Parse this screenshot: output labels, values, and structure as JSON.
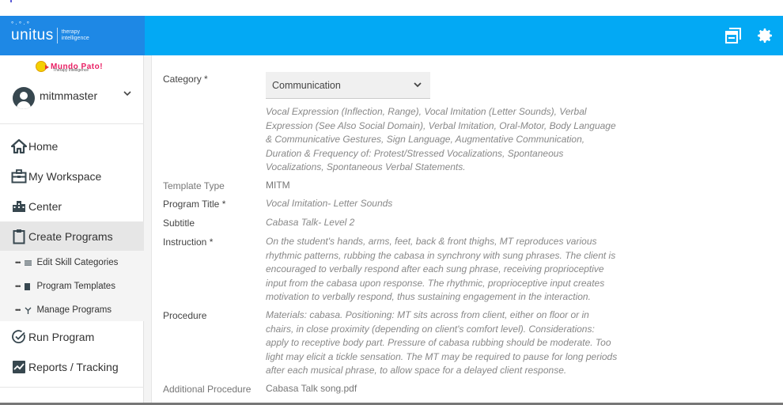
{
  "header": {
    "brand_name": "unitus",
    "brand_tagline_1": "therapy",
    "brand_tagline_2": "intelligence",
    "icons": [
      "windows-icon",
      "gear-icon"
    ]
  },
  "sidebar": {
    "partner_logo_title": "Mundo Pato!",
    "partner_logo_subtitle": "Therapy Intelligence",
    "username": "mitmmaster",
    "nav": [
      {
        "label": "Home",
        "icon": "home-icon"
      },
      {
        "label": "My Workspace",
        "icon": "briefcase-icon"
      },
      {
        "label": "Center",
        "icon": "building-icon"
      },
      {
        "label": "Create Programs",
        "icon": "clipboard-icon",
        "active": true
      },
      {
        "label": "Run Program",
        "icon": "check-circle-icon"
      },
      {
        "label": "Reports / Tracking",
        "icon": "chart-icon"
      }
    ],
    "sub_nav": [
      {
        "label": "Edit Skill Categories",
        "icon": "list-icon"
      },
      {
        "label": "Program Templates",
        "icon": "bookmark-icon"
      },
      {
        "label": "Manage Programs",
        "icon": "branch-icon"
      }
    ]
  },
  "form": {
    "category": {
      "label": "Category *",
      "value": "Communication",
      "description": "Vocal Expression (Inflection, Range), Vocal Imitation (Letter Sounds), Verbal Expression (See Also Social Domain), Verbal Imitation, Oral-Motor, Body Language & Communicative Gestures, Sign Language, Augmentative Communication, Duration & Frequency of: Protest/Stressed Vocalizations, Spontaneous Vocalizations, Spontaneous Verbal Statements."
    },
    "template_type": {
      "label": "Template Type",
      "value": "MITM"
    },
    "program_title": {
      "label": "Program Title *",
      "value": "Vocal Imitation- Letter Sounds"
    },
    "subtitle": {
      "label": "Subtitle",
      "value": "Cabasa Talk- Level 2"
    },
    "instruction": {
      "label": "Instruction *",
      "value": "On the student's hands, arms, feet, back & front thighs, MT reproduces various rhythmic patterns, rubbing the cabasa in synchrony with sung phrases. The client is encouraged to verbally respond after each sung phrase, receiving proprioceptive input from the cabasa upon response. The rhythmic, proprioceptive input creates motivation to verbally respond, thus sustaining engagement in the interaction."
    },
    "procedure": {
      "label": "Procedure",
      "value": "Materials: cabasa. Positioning: MT sits across from client, either on floor or in chairs, in close proximity (depending on client's comfort level). Considerations: apply to receptive body part. Pressure of cabasa rubbing should be moderate. Too light may elicit a tickle sensation. The MT may be required to pause for long periods after each musical phrase, to allow space for a delayed client response."
    },
    "additional_procedure": {
      "label": "Additional Procedure",
      "value": "Cabasa Talk song.pdf"
    }
  },
  "colors": {
    "header_bg": "#03a9f4",
    "brand_bg": "#1e88e5",
    "active_nav_bg": "#e6e6e6",
    "sub_nav_bg": "#f4f4f4"
  }
}
